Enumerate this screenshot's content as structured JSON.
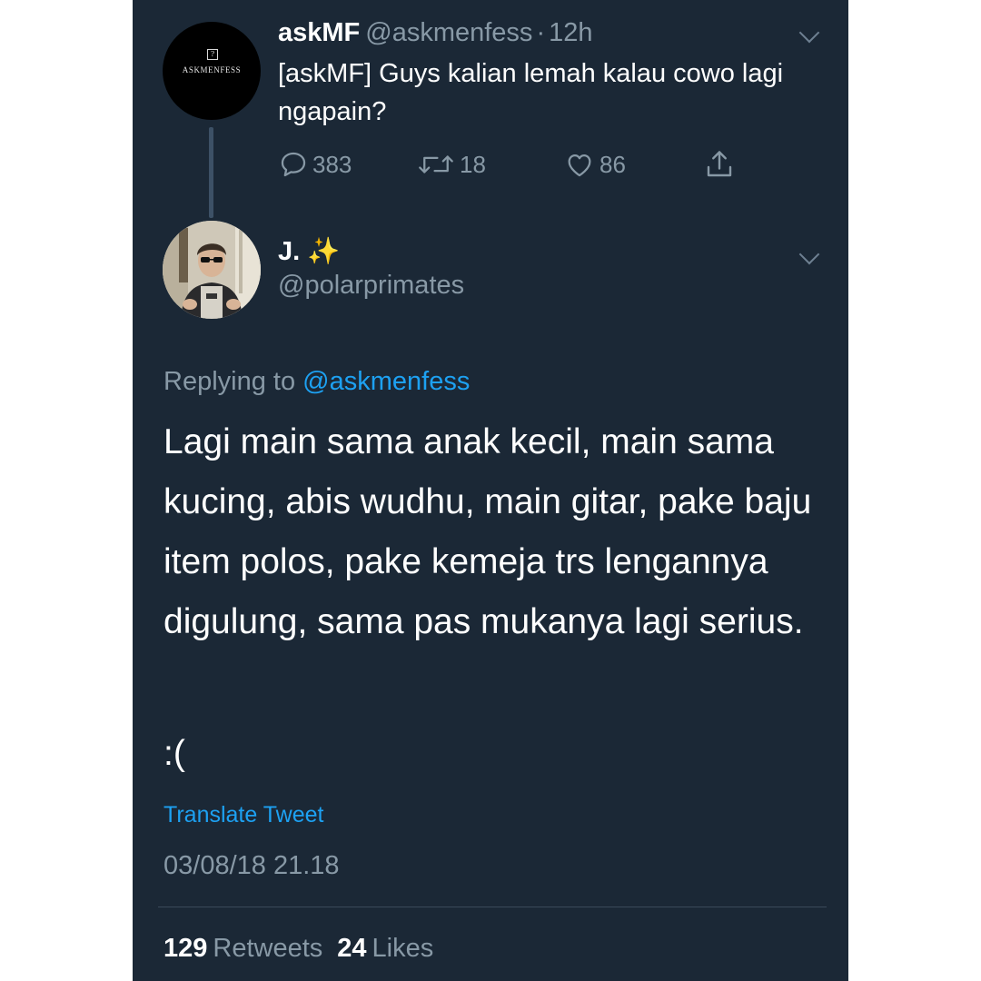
{
  "original_tweet": {
    "avatar_logo_text": "ASKMENFESS",
    "avatar_logo_mark": "?",
    "display_name": "askMF",
    "handle": "@askmenfess",
    "separator": "·",
    "time_ago": "12h",
    "text": "[askMF] Guys kalian lemah kalau cowo lagi ngapain?",
    "actions": {
      "replies": "383",
      "retweets": "18",
      "likes": "86"
    },
    "icons": [
      "chevron-down-icon",
      "reply-icon",
      "retweet-icon",
      "like-icon",
      "share-icon"
    ]
  },
  "reply_tweet": {
    "display_name": "J.",
    "name_emoji": "✨",
    "handle": "@polarprimates",
    "replying_prefix": "Replying to",
    "replying_mention": "@askmenfess",
    "body": "Lagi main sama anak kecil, main sama kucing, abis wudhu, main gitar, pake baju item polos, pake kemeja trs lengannya digulung, sama pas mukanya lagi serius.",
    "emote": ":(",
    "translate_label": "Translate Tweet",
    "timestamp": "03/08/18 21.18",
    "stats": {
      "retweets_count": "129",
      "retweets_label": "Retweets",
      "likes_count": "24",
      "likes_label": "Likes"
    }
  },
  "colors": {
    "background": "#1b2836",
    "primary_text": "#ffffff",
    "secondary_text": "#8899a6",
    "link": "#1da1f2"
  }
}
